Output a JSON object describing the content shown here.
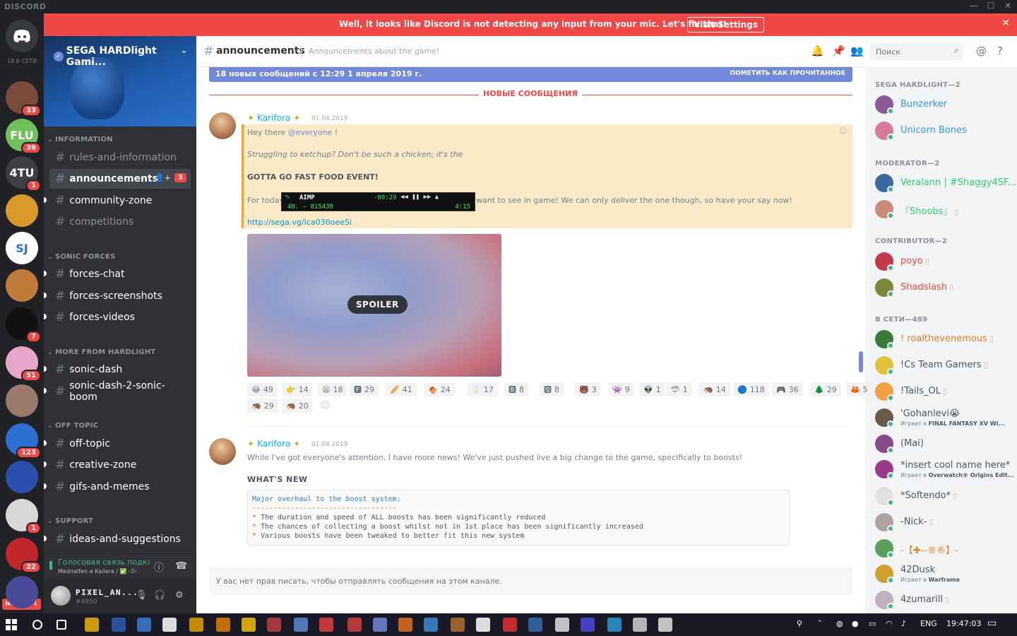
{
  "titlebar": {
    "brand": "DISCORD",
    "min": "—",
    "max": "☐",
    "close": "✕"
  },
  "notice": {
    "message": "Well, it looks like Discord is not detecting any input from your mic. Let's fix that!",
    "button": "Visit Settings",
    "close": "✕"
  },
  "rail": {
    "online_label": "18 В СЕТИ",
    "new_label": "НОВОЕ ↓",
    "servers": [
      {
        "label": "",
        "badge": "33",
        "color": "#7a4a3a"
      },
      {
        "label": "FLU",
        "badge": "39",
        "color": "#6fbf5a"
      },
      {
        "label": "4TU",
        "badge": "1",
        "color": "#3d3f44"
      },
      {
        "label": "",
        "badge": "",
        "color": "#d99a2b"
      },
      {
        "label": "SJ",
        "badge": "",
        "color": "#ffffff"
      },
      {
        "label": "",
        "badge": "",
        "color": "#c07a3a"
      },
      {
        "label": "",
        "badge": "7",
        "color": "#111111"
      },
      {
        "label": "",
        "badge": "51",
        "color": "#e7a6c9"
      },
      {
        "label": "",
        "badge": "",
        "color": "#9a7a6a"
      },
      {
        "label": "",
        "badge": "123",
        "color": "#2a6fd1"
      },
      {
        "label": "",
        "badge": "",
        "color": "#2a4fb0"
      },
      {
        "label": "",
        "badge": "1",
        "color": "#d8d8d8"
      },
      {
        "label": "",
        "badge": "22",
        "color": "#c0262c"
      },
      {
        "label": "",
        "badge": "",
        "color": "#4a4a9a"
      }
    ]
  },
  "server": {
    "name": "SEGA HARDlight Gami...",
    "categories": [
      {
        "name": "INFORMATION"
      },
      {
        "name": "SONIC FORCES"
      },
      {
        "name": "MORE FROM HARDLIGHT"
      },
      {
        "name": "OFF TOPIC"
      },
      {
        "name": "SUPPORT"
      }
    ],
    "channels": [
      {
        "name": "rules-and-information",
        "state": "read"
      },
      {
        "name": "announcements",
        "state": "active",
        "badge": "3"
      },
      {
        "name": "community-zone",
        "state": "unread"
      },
      {
        "name": "competitions",
        "state": "read"
      },
      {
        "name": "forces-chat",
        "state": "unread"
      },
      {
        "name": "forces-screenshots",
        "state": "unread"
      },
      {
        "name": "forces-videos",
        "state": "unread"
      },
      {
        "name": "sonic-dash",
        "state": "unread"
      },
      {
        "name": "sonic-dash-2-sonic-boom",
        "state": "unread"
      },
      {
        "name": "off-topic",
        "state": "unread"
      },
      {
        "name": "creative-zone",
        "state": "unread"
      },
      {
        "name": "gifs-and-memes",
        "state": "unread"
      },
      {
        "name": "ideas-and-suggestions",
        "state": "unread"
      }
    ]
  },
  "voice": {
    "title": "Голосовая связь подкл...",
    "subtitle": "Mednalfen и Kailera / ✅ -ℬ-"
  },
  "user": {
    "name": "PIXEL_AN...",
    "discriminator": "#4950"
  },
  "header": {
    "channel": "announcements",
    "topic": "Announcements about the game!",
    "search_placeholder": "Поиск"
  },
  "newbar": {
    "left": "18 новых сообщений с 12:29 1 апреля 2019 г.",
    "right": "ПОМЕТИТЬ КАК ПРОЧИТАННОЕ"
  },
  "new_divider": "НОВЫЕ СООБЩЕНИЯ",
  "messages": [
    {
      "author": "Karifora",
      "timestamp": "01.04.2019",
      "greeting_pre": "Hey there ",
      "mention": "@everyone",
      "greeting_post": " !",
      "line2": "Struggling to ketchup? Don't be such a chicken; it's the",
      "line3": "GOTTA GO FAST FOOD EVENT!",
      "line4_pre": "For today",
      "line4_post": "want to see in game! We can only deliver the one though, so have your say now!",
      "link": "http://sega.vg/Ica030oeeSi",
      "spoiler_label": "SPOILER",
      "reactions": [
        {
          "emoji": "😂",
          "count": "49"
        },
        {
          "emoji": "👉",
          "count": "14"
        },
        {
          "emoji": "😫",
          "count": "18"
        },
        {
          "emoji": "🅵",
          "count": "29"
        },
        {
          "emoji": "🥖",
          "count": "41"
        },
        {
          "emoji": "🍖",
          "count": "24"
        },
        {
          "emoji": "🥛",
          "count": "17"
        },
        {
          "emoji": "🅱",
          "count": "8"
        },
        {
          "emoji": "🆀",
          "count": "8"
        },
        {
          "emoji": "🐻",
          "count": "3"
        },
        {
          "emoji": "👾",
          "count": "9"
        },
        {
          "emoji": "👽",
          "count": "1"
        },
        {
          "emoji": "🦈",
          "count": "1"
        },
        {
          "emoji": "🦔",
          "count": "14"
        },
        {
          "emoji": "🔵",
          "count": "118"
        },
        {
          "emoji": "🎮",
          "count": "36"
        },
        {
          "emoji": "🌲",
          "count": "29"
        },
        {
          "emoji": "🦀",
          "count": "5"
        },
        {
          "emoji": "🦔",
          "count": "29"
        },
        {
          "emoji": "🦔",
          "count": "20"
        }
      ]
    },
    {
      "author": "Karifora",
      "timestamp": "01.04.2019",
      "text": "While I've got everyone's attention, I have more news! We've just pushed live a big change to the game, specifically to boosts!",
      "heading": "WHAT'S NEW",
      "code_title": "Major overhaul to the boost system:",
      "code_rule": "----------------------------------",
      "code_items": [
        "The duration and speed of ALL boosts has been significantly reduced",
        "The chances of collecting a boost whilst not in 1st place has been significantly increased",
        "Various boosts have been tweaked to better fit this new system"
      ]
    }
  ],
  "aimp": {
    "title": "AIMP",
    "time": "-00:29",
    "band": "40. ‒ 815430",
    "duration": "4:15"
  },
  "composer": {
    "placeholder": "У вас нет прав писать, чтобы отправлять сообщения на этом канале."
  },
  "members": {
    "groups": [
      {
        "title": "SEGA HARDLIGHT—2",
        "members": [
          {
            "name": "Bunzerker",
            "color": "#3498db",
            "sub": "",
            "av": "#8a5a9a"
          },
          {
            "name": "Unicorn Bones",
            "color": "#3498db",
            "sub": "",
            "av": "#d97a9a"
          }
        ]
      },
      {
        "title": "MODERATOR—2",
        "members": [
          {
            "name": "Veralann | #Shaggy4SF...",
            "color": "#2ecc71",
            "sub": "",
            "av": "#3c6aa0"
          },
          {
            "name": "『Shoobs』",
            "color": "#2ecc71",
            "sub": "",
            "av": "#c98a7a",
            "phone": true
          }
        ]
      },
      {
        "title": "CONTRIBUTOR—2",
        "members": [
          {
            "name": "poyo",
            "color": "#e74c3c",
            "sub": "",
            "av": "#c23a4a",
            "phone": true
          },
          {
            "name": "Shadslash",
            "color": "#e74c3c",
            "sub": "",
            "av": "#7a8a3a",
            "phone": true
          }
        ]
      },
      {
        "title": "В СЕТИ—489",
        "members": [
          {
            "name": "! roalthevenemous",
            "color": "#e67e22",
            "sub": "",
            "av": "#3a7a3a",
            "phone": true
          },
          {
            "name": "!Cs Team Gamers",
            "color": "#4f5660",
            "sub": "",
            "av": "#e2c23a",
            "phone": true
          },
          {
            "name": "!Tails_OL",
            "color": "#4f5660",
            "sub": "",
            "av": "#f0a040",
            "phone": true
          },
          {
            "name": "'Gohanlevi😭",
            "color": "#4f5660",
            "sub_pre": "Играет в ",
            "sub": "FINAL FANTASY XV WI...",
            "av": "#6a5a4a"
          },
          {
            "name": "(Mai)",
            "color": "#4f5660",
            "sub": "",
            "av": "#8a4a8a"
          },
          {
            "name": "*insert cool name here*",
            "color": "#4f5660",
            "sub_pre": "Играет в ",
            "sub": "Overwatch® Origins Edit...",
            "av": "#9a3a8a"
          },
          {
            "name": "*Softendo*",
            "color": "#4f5660",
            "sub": "",
            "av": "#e0e0e0",
            "phone": true
          },
          {
            "name": "-Nick-",
            "color": "#4f5660",
            "sub": "",
            "av": "#b0a0a0",
            "phone": true
          },
          {
            "name": "-【✚--®®】-",
            "color": "#e67e22",
            "sub": "",
            "av": "#5aa05a"
          },
          {
            "name": "42Dusk",
            "color": "#4f5660",
            "sub_pre": "Играет в ",
            "sub": "Warframe",
            "av": "#d0a030"
          },
          {
            "name": "4zumarill",
            "color": "#4f5660",
            "sub": "",
            "av": "#c0b0c0",
            "phone": true
          }
        ]
      }
    ]
  },
  "taskbar": {
    "lang": "ENG",
    "time": "19:47:03"
  }
}
